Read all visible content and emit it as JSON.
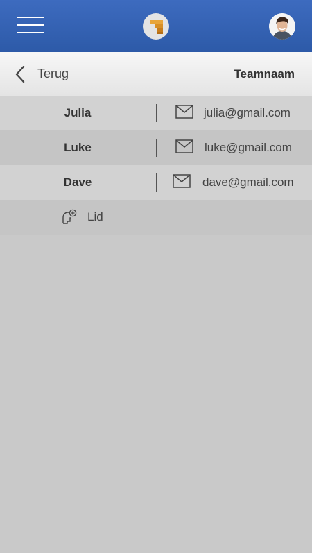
{
  "header": {
    "menu_icon": "hamburger-icon",
    "logo_icon": "app-logo",
    "avatar_icon": "user-avatar"
  },
  "subheader": {
    "back_label": "Terug",
    "team_name": "Teamnaam"
  },
  "members": [
    {
      "name": "Julia",
      "email": "julia@gmail.com"
    },
    {
      "name": "Luke",
      "email": "luke@gmail.com"
    },
    {
      "name": "Dave",
      "email": "dave@gmail.com"
    }
  ],
  "add_member": {
    "label": "Lid",
    "icon": "add-member-icon"
  },
  "colors": {
    "header_blue": "#3a67b8",
    "background": "#c9c9c9",
    "logo_orange": "#e3a43a"
  }
}
